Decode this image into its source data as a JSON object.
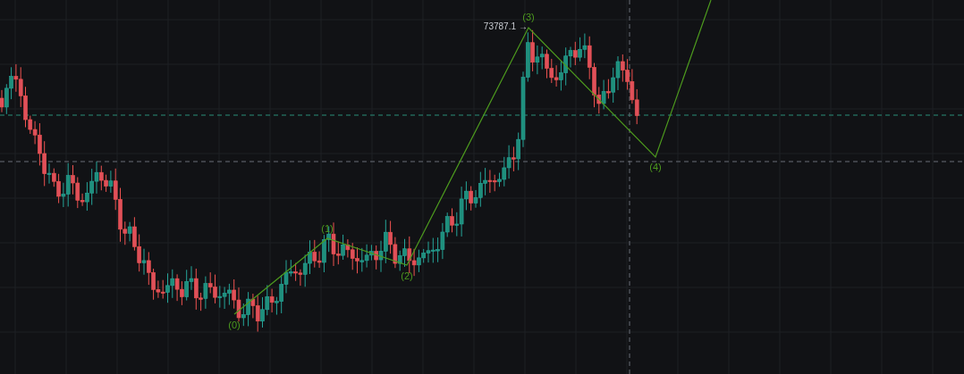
{
  "wave_labels": [
    {
      "label": "(0)"
    },
    {
      "label": "(1)"
    },
    {
      "label": "(2)"
    },
    {
      "label": "(3)"
    },
    {
      "label": "(4)"
    }
  ],
  "price_marker": {
    "value": "73787.1",
    "arrow": "→"
  }
}
